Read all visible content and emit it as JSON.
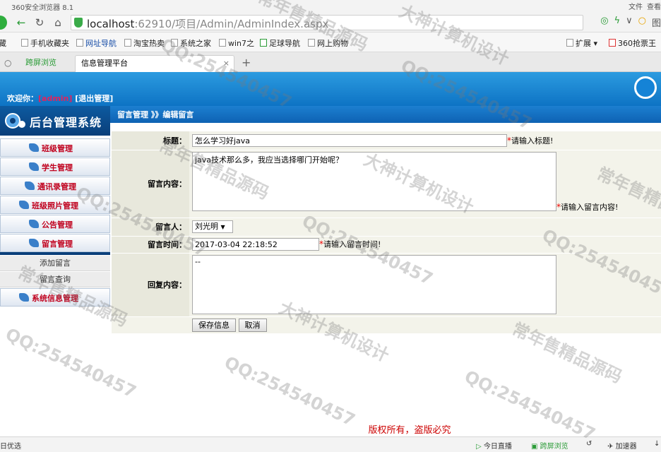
{
  "browser": {
    "title": "360安全浏览器 8.1",
    "top_right": [
      "文件",
      "查看"
    ],
    "url_host": "localhost",
    "url_rest": ":62910/项目/Admin/AdminIndex.aspx",
    "address_right": "图",
    "bookmarks": [
      "手机收藏夹",
      "网址导航",
      "淘宝热卖",
      "系统之家",
      "win7之",
      "足球导航",
      "网上购物",
      "扩展",
      "360抢票王"
    ],
    "bookmark_prefix": "藏",
    "tabs": {
      "fast": "跨屏浏览",
      "main": "信息管理平台",
      "close": "×",
      "new": "+"
    }
  },
  "app": {
    "welcome": "欢迎你：",
    "user": "[admin]",
    "logout": "[退出管理]",
    "system_title": "后台管理系统",
    "breadcrumb": "留言管理 》》编辑留言"
  },
  "sidebar": {
    "items": [
      {
        "label": "班级管理"
      },
      {
        "label": "学生管理"
      },
      {
        "label": "通讯录管理"
      },
      {
        "label": "班级照片管理"
      },
      {
        "label": "公告管理"
      },
      {
        "label": "留言管理"
      }
    ],
    "subitems": [
      "添加留言",
      "留言查询"
    ],
    "last_item": "系统信息管理"
  },
  "form": {
    "title_label": "标题：",
    "title_value": "怎么学习好java",
    "title_hint": "请输入标题!",
    "content_label": "留言内容：",
    "content_value": "java技术那么多，我应当选择哪门开始呢？",
    "content_hint": "请输入留言内容!",
    "author_label": "留言人：",
    "author_value": "刘光明",
    "time_label": "留言时间：",
    "time_value": "2017-03-04 22:18:52",
    "time_hint": "请输入留言时间!",
    "reply_label": "回复内容：",
    "reply_value": "--",
    "required_mark": "*",
    "save_button": "保存信息",
    "cancel_button": "取消"
  },
  "footer": {
    "copyright": "版权所有，盗版必究"
  },
  "statusbar": {
    "left": "日优选",
    "live": "今日直播",
    "fast": "跨屏浏览",
    "speed": "加速器",
    "down": "↓"
  },
  "watermarks": [
    "常年售精品源码",
    "大神计算机设计",
    "QQ:254540457"
  ]
}
